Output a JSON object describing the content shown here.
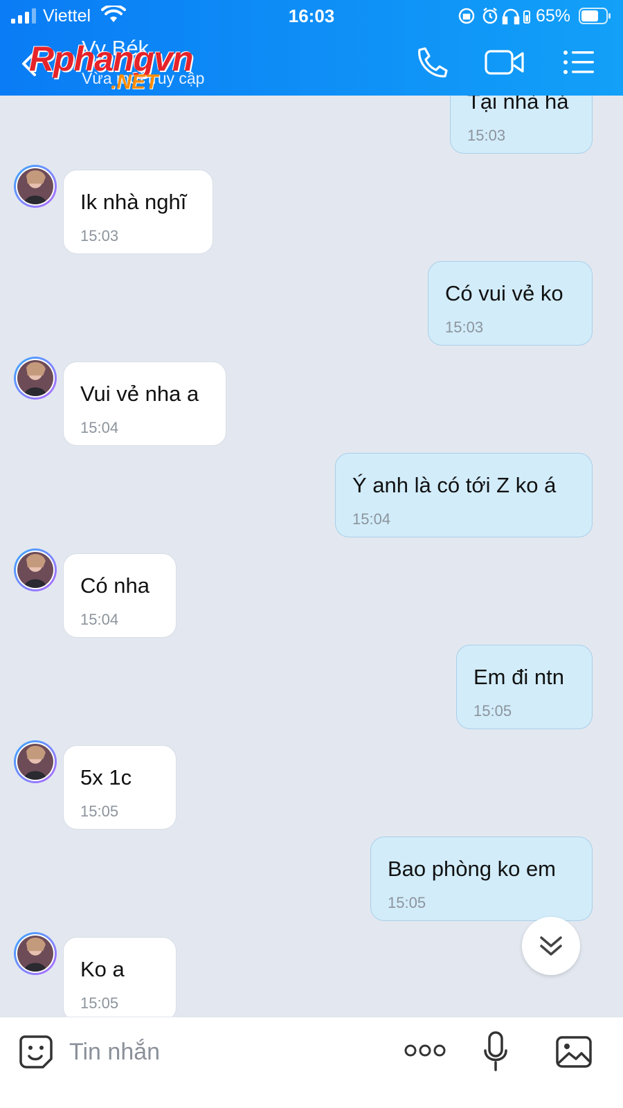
{
  "status_bar": {
    "carrier": "Viettel",
    "time": "16:03",
    "battery": "65%"
  },
  "header": {
    "contact_name": "Vy Bék",
    "contact_status": "Vừa mới truy cập",
    "watermark_main": "Rphangvn",
    "watermark_sub": ".NET"
  },
  "messages": [
    {
      "direction": "out",
      "text": "Tại nhà hả",
      "time": "15:03"
    },
    {
      "direction": "in",
      "text": "Ik nhà nghĩ",
      "time": "15:03"
    },
    {
      "direction": "out",
      "text": "Có vui vẻ ko",
      "time": "15:03"
    },
    {
      "direction": "in",
      "text": "Vui vẻ nha a",
      "time": "15:04"
    },
    {
      "direction": "out",
      "text": "Ý anh là có tới Z ko á",
      "time": "15:04"
    },
    {
      "direction": "in",
      "text": "Có nha",
      "time": "15:04"
    },
    {
      "direction": "out",
      "text": "Em đi ntn",
      "time": "15:05"
    },
    {
      "direction": "in",
      "text": "5x 1c",
      "time": "15:05"
    },
    {
      "direction": "out",
      "text": "Bao phòng ko em",
      "time": "15:05"
    },
    {
      "direction": "in",
      "text": "Ko a",
      "time": "15:05"
    }
  ],
  "input": {
    "placeholder": "Tin nhắn"
  },
  "colors": {
    "header": "#0a7cf5",
    "bubble_out": "#d2ecfa",
    "bubble_in": "#ffffff",
    "background": "#e3e8f0"
  }
}
